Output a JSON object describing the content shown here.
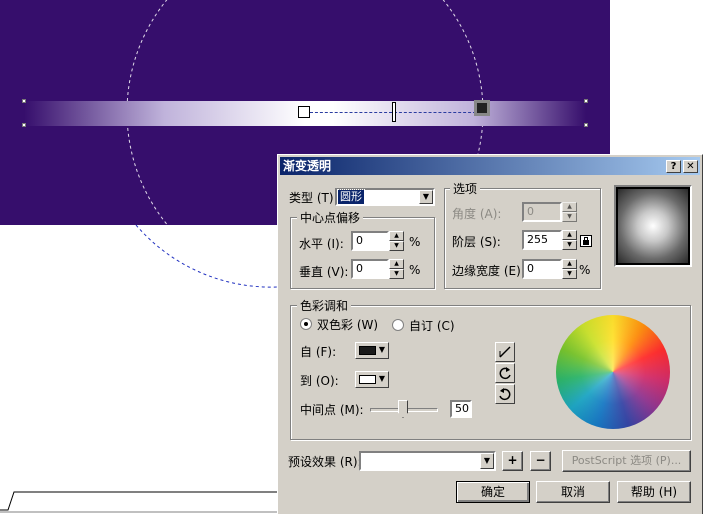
{
  "dialog": {
    "title": "渐变透明",
    "help_btn": "?",
    "close_btn": "✕",
    "type_label": "类型 (T)",
    "type_value": "圆形",
    "center_offset": {
      "title": "中心点偏移",
      "horizontal_label": "水平 (I):",
      "horizontal_value": "0",
      "vertical_label": "垂直 (V):",
      "vertical_value": "0",
      "unit": "%"
    },
    "options": {
      "title": "选项",
      "angle_label": "角度 (A):",
      "angle_value": "0",
      "steps_label": "阶层 (S):",
      "steps_value": "255",
      "edge_label": "边缘宽度 (E):",
      "edge_value": "0",
      "unit": "%"
    },
    "blend": {
      "title": "色彩调和",
      "two_color_label": "双色彩 (W)",
      "custom_label": "自订 (C)",
      "from_label": "自 (F):",
      "to_label": "到 (O):",
      "midpoint_label": "中间点 (M):",
      "midpoint_value": "50",
      "from_color": "#1a1a1a",
      "to_color": "#ffffff",
      "midpoint_fraction": 0.5
    },
    "presets_label": "预设效果 (R):",
    "presets_value": "",
    "add_preset": "+",
    "remove_preset": "−",
    "postscript_btn": "PostScript 选项 (P)...",
    "ok_btn": "确定",
    "cancel_btn": "取消",
    "help_label": "帮助 (H)"
  },
  "colors": {
    "canvas_bg": "#360e6c",
    "title_bar": "#0a246a",
    "dialog_bg": "#d4d0c8"
  }
}
